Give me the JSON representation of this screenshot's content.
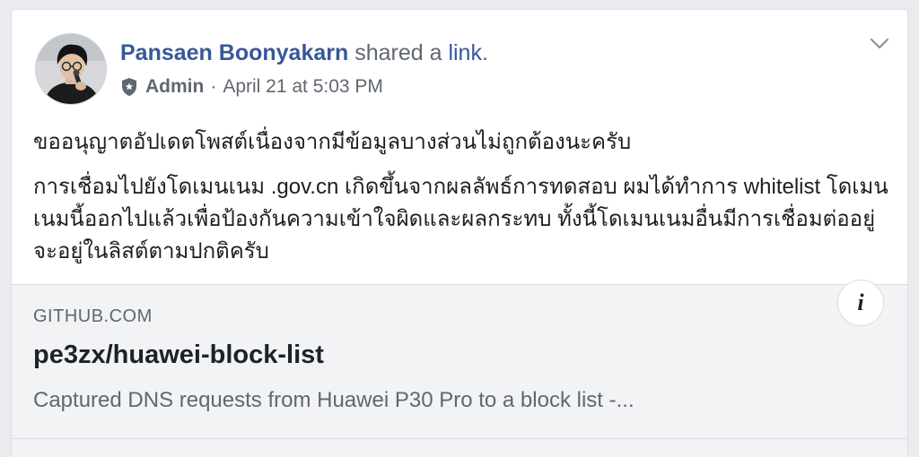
{
  "post": {
    "author": "Pansaen Boonyakarn",
    "action_text": " shared a ",
    "action_link": "link",
    "action_end": ".",
    "role": "Admin",
    "separator": "·",
    "timestamp": "April 21 at 5:03 PM",
    "paragraphs": [
      "ขออนุญาตอัปเดตโพสต์เนื่องจากมีข้อมูลบางส่วนไม่ถูกต้องนะครับ",
      "การเชื่อมไปยังโดเมนเนม .gov.cn เกิดขึ้นจากผลลัพธ์การทดสอบ ผมได้ทำการ whitelist โดเมนเนมนี้ออกไปแล้วเพื่อป้องกันความเข้าใจผิดและผลกระทบ ทั้งนี้โดเมนเนมอื่นมีการเชื่อมต่ออยู่จะอยู่ในลิสต์ตามปกติครับ"
    ]
  },
  "link_card": {
    "domain": "GITHUB.COM",
    "title": "pe3zx/huawei-block-list",
    "description": "Captured DNS requests from Huawei P30 Pro to a block list -...",
    "info_glyph": "i"
  },
  "icons": {
    "shield": "shield-icon",
    "chevron": "chevron-down-icon",
    "info": "info-icon",
    "avatar": "avatar"
  },
  "colors": {
    "author_link": "#385898",
    "meta_gray": "#606770",
    "body_text": "#1c1e21",
    "card_bg": "#f2f3f5",
    "page_bg": "#e9ebee"
  }
}
